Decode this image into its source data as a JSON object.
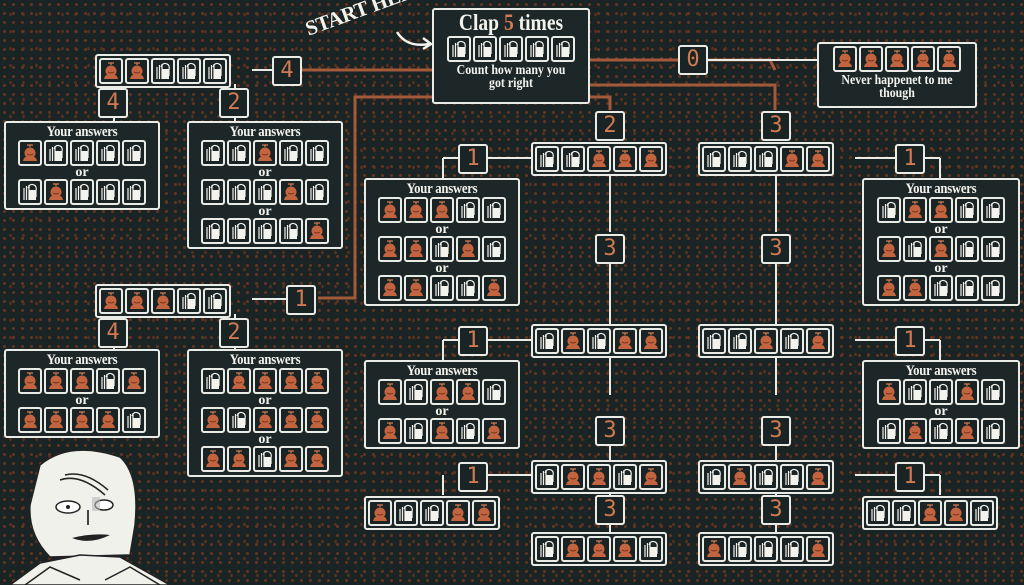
{
  "legend": {
    "C": "clap-icon",
    "B": "stomp-icon"
  },
  "colors": {
    "background": "#1b2424",
    "accent": "#d07a52",
    "border": "#e9ece6",
    "trace": "#8a4428"
  },
  "start_label": "START HERE",
  "main": {
    "title_pre": "Clap ",
    "title_num": "5",
    "title_post": " times",
    "pattern": [
      "C",
      "C",
      "C",
      "C",
      "C"
    ],
    "subtitle_line1": "Count how many you",
    "subtitle_line2": "got right"
  },
  "zero_branch": {
    "count": "0",
    "pattern": [
      "B",
      "B",
      "B",
      "B",
      "B"
    ],
    "caption_line1": "Never happenet to me",
    "caption_line2": "though"
  },
  "answers_title": "Your answers",
  "or_label": "or",
  "left_branch_4": {
    "count": "4",
    "pattern": [
      "B",
      "B",
      "C",
      "C",
      "C"
    ],
    "sub4": {
      "count": "4",
      "answers": [
        [
          "B",
          "C",
          "C",
          "C",
          "C"
        ],
        [
          "C",
          "B",
          "C",
          "C",
          "C"
        ]
      ]
    },
    "sub2": {
      "count": "2",
      "answers": [
        [
          "C",
          "C",
          "B",
          "C",
          "C"
        ],
        [
          "C",
          "C",
          "C",
          "B",
          "C"
        ],
        [
          "C",
          "C",
          "C",
          "C",
          "B"
        ]
      ]
    }
  },
  "left_branch_1": {
    "count": "1",
    "pattern": [
      "B",
      "B",
      "B",
      "C",
      "C"
    ],
    "sub4": {
      "count": "4",
      "answers": [
        [
          "B",
          "B",
          "B",
          "C",
          "B"
        ],
        [
          "B",
          "B",
          "B",
          "B",
          "C"
        ]
      ]
    },
    "sub2": {
      "count": "2",
      "answers": [
        [
          "C",
          "B",
          "B",
          "B",
          "B"
        ],
        [
          "B",
          "C",
          "B",
          "B",
          "B"
        ],
        [
          "B",
          "B",
          "C",
          "B",
          "B"
        ]
      ]
    }
  },
  "mid_branch": {
    "count": "2",
    "steps": [
      {
        "pattern": [
          "C",
          "C",
          "B",
          "B",
          "B"
        ],
        "side_count": "1",
        "answers": [
          [
            "B",
            "B",
            "B",
            "C",
            "C"
          ],
          [
            "B",
            "B",
            "C",
            "B",
            "C"
          ],
          [
            "B",
            "B",
            "C",
            "C",
            "B"
          ]
        ],
        "next_count": "3"
      },
      {
        "pattern": [
          "C",
          "B",
          "C",
          "B",
          "B"
        ],
        "side_count": "1",
        "answers": [
          [
            "B",
            "C",
            "B",
            "B",
            "C"
          ],
          [
            "B",
            "C",
            "B",
            "C",
            "B"
          ]
        ],
        "next_count": "3"
      },
      {
        "pattern": [
          "C",
          "B",
          "B",
          "C",
          "B"
        ],
        "side_count": "1",
        "answers": [
          [
            "B",
            "C",
            "C",
            "B",
            "B"
          ]
        ],
        "next_count": "3"
      }
    ],
    "final": [
      "C",
      "B",
      "B",
      "B",
      "C"
    ]
  },
  "right_branch": {
    "count": "3",
    "steps": [
      {
        "pattern": [
          "C",
          "C",
          "C",
          "B",
          "B"
        ],
        "side_count": "1",
        "answers": [
          [
            "C",
            "B",
            "B",
            "C",
            "C"
          ],
          [
            "B",
            "C",
            "B",
            "C",
            "C"
          ],
          [
            "B",
            "B",
            "C",
            "C",
            "C"
          ]
        ],
        "next_count": "3"
      },
      {
        "pattern": [
          "C",
          "C",
          "B",
          "C",
          "B"
        ],
        "side_count": "1",
        "answers": [
          [
            "B",
            "C",
            "C",
            "B",
            "C"
          ],
          [
            "C",
            "B",
            "C",
            "B",
            "C"
          ]
        ],
        "next_count": "3"
      },
      {
        "pattern": [
          "C",
          "B",
          "C",
          "C",
          "B"
        ],
        "side_count": "1",
        "answers": [
          [
            "C",
            "C",
            "B",
            "B",
            "C"
          ]
        ],
        "next_count": "3"
      }
    ],
    "final": [
      "B",
      "C",
      "C",
      "C",
      "B"
    ]
  }
}
